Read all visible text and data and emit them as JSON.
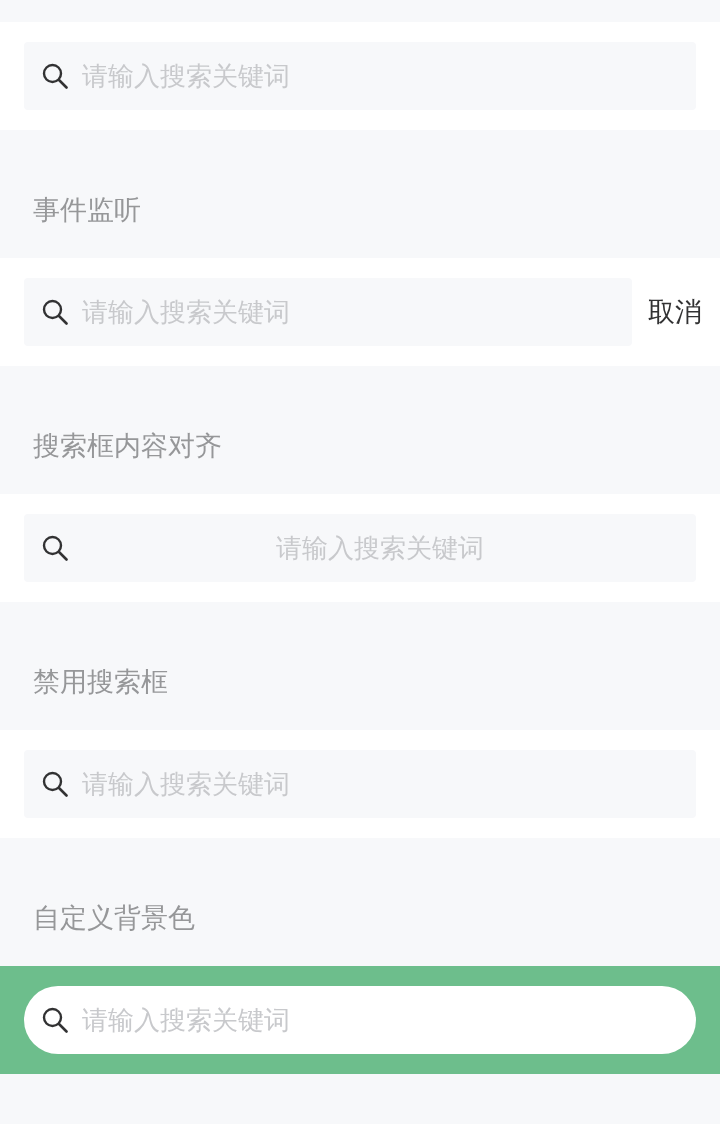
{
  "demos": [
    {
      "search": {
        "placeholder": "请输入搜索关键词",
        "kind": "plain"
      }
    },
    {
      "title": "事件监听",
      "search": {
        "placeholder": "请输入搜索关键词",
        "kind": "plain",
        "action": "取消"
      }
    },
    {
      "title": "搜索框内容对齐",
      "search": {
        "placeholder": "请输入搜索关键词",
        "kind": "centered"
      }
    },
    {
      "title": "禁用搜索框",
      "search": {
        "placeholder": "请输入搜索关键词",
        "kind": "plain"
      }
    },
    {
      "title": "自定义背景色",
      "search": {
        "placeholder": "请输入搜索关键词",
        "kind": "rounded",
        "color": "#6dbe8c"
      }
    }
  ]
}
